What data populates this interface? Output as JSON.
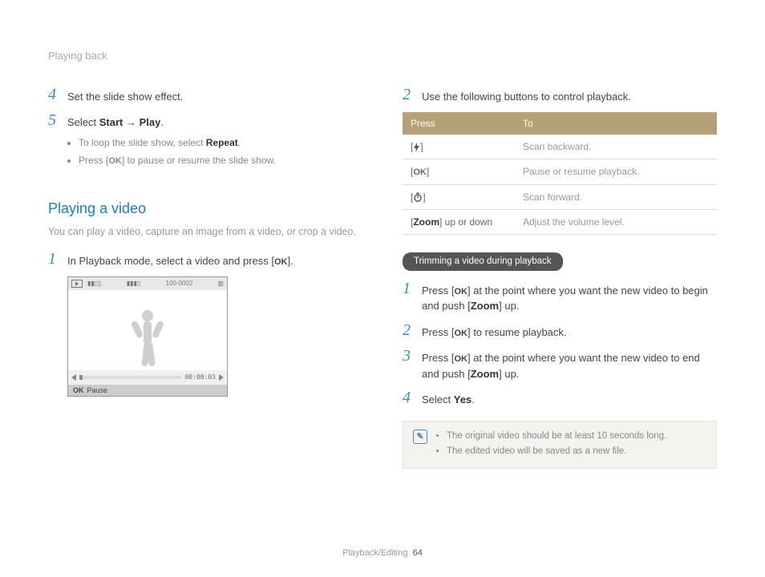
{
  "header": {
    "breadcrumb": "Playing back"
  },
  "left": {
    "step4": {
      "num": "4",
      "text": "Set the slide show effect."
    },
    "step5": {
      "num": "5",
      "lead": "Select ",
      "bold1": "Start",
      "arrow": " → ",
      "bold2": "Play",
      "trail": ".",
      "bullets": {
        "a_pre": "To loop the slide show, select ",
        "a_bold": "Repeat",
        "a_post": ".",
        "b_pre": "Press [",
        "b_ok": "OK",
        "b_post": "] to pause or resume the slide show."
      }
    },
    "section": {
      "title": "Playing a video",
      "sub": "You can play a video, capture an image from a video, or crop a video."
    },
    "v_step1": {
      "num": "1",
      "pre": "In Playback mode, select a video and press [",
      "ok": "OK",
      "post": "]."
    },
    "shot": {
      "topcode": "100-0002",
      "time": "00:00:03",
      "foot_ok": "OK",
      "foot_label": "Pause"
    }
  },
  "right": {
    "step2": {
      "num": "2",
      "text": "Use the following buttons to control playback."
    },
    "table": {
      "h1": "Press",
      "h2": "To",
      "rows": [
        {
          "press_pre": "[",
          "press_icon": "bolt",
          "press_post": "]",
          "to": "Scan backward."
        },
        {
          "press_pre": "[",
          "press_icon": "ok",
          "press_post": "]",
          "to": "Pause or resume playback."
        },
        {
          "press_pre": "[",
          "press_icon": "clock",
          "press_post": "]",
          "to": "Scan forward."
        },
        {
          "press_text": "[Zoom] up or down",
          "to": "Adjust the volume level."
        }
      ]
    },
    "pill": "Trimming a video during playback",
    "t_step1": {
      "num": "1",
      "pre": "Press [",
      "ok": "OK",
      "mid": "] at the point where you want the new video to begin and push [",
      "zoom": "Zoom",
      "post": "] up."
    },
    "t_step2": {
      "num": "2",
      "pre": "Press [",
      "ok": "OK",
      "post": "] to resume playback."
    },
    "t_step3": {
      "num": "3",
      "pre": "Press [",
      "ok": "OK",
      "mid": "] at the point where you want the new video to end and push [",
      "zoom": "Zoom",
      "post": "] up."
    },
    "t_step4": {
      "num": "4",
      "pre": "Select ",
      "yes": "Yes",
      "post": "."
    },
    "note": {
      "a": "The original video should be at least 10 seconds long.",
      "b": "The edited video will be saved as a new file."
    }
  },
  "footer": {
    "section": "Playback/Editing",
    "page": "64"
  }
}
